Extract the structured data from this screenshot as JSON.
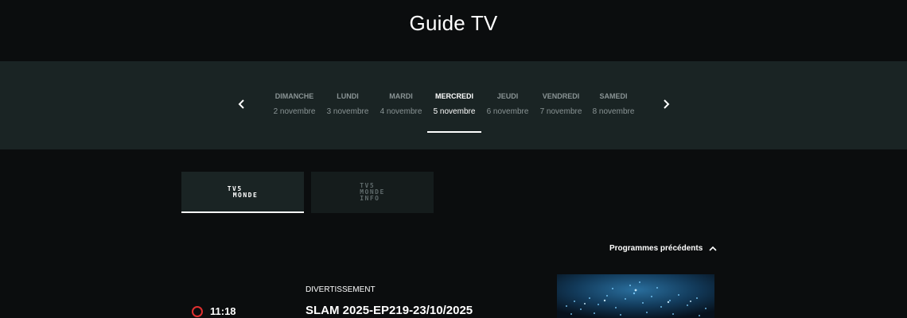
{
  "page": {
    "title": "Guide TV"
  },
  "days": [
    {
      "name": "DIMANCHE",
      "date": "2 novembre",
      "active": false
    },
    {
      "name": "LUNDI",
      "date": "3 novembre",
      "active": false
    },
    {
      "name": "MARDI",
      "date": "4 novembre",
      "active": false
    },
    {
      "name": "MERCREDI",
      "date": "5 novembre",
      "active": true
    },
    {
      "name": "JEUDI",
      "date": "6 novembre",
      "active": false
    },
    {
      "name": "VENDREDI",
      "date": "7 novembre",
      "active": false
    },
    {
      "name": "SAMEDI",
      "date": "8 novembre",
      "active": false
    }
  ],
  "channels": [
    {
      "logo_lines": [
        "TV5",
        "MONDE"
      ],
      "active": true
    },
    {
      "logo_lines": [
        "TV5",
        "MONDE",
        "INFO"
      ],
      "active": false
    }
  ],
  "previous_programs": {
    "label": "Programmes précédents",
    "icon": "chevron-up-icon"
  },
  "program": {
    "time": "11:18",
    "genre": "DIVERTISSEMENT",
    "title": "SLAM 2025-EP219-23/10/2025",
    "live_icon": "live-indicator-icon"
  },
  "colors": {
    "background": "#0b0d0e",
    "band": "#1a2424",
    "live": "#e03030",
    "muted_text": "#8a9495"
  }
}
